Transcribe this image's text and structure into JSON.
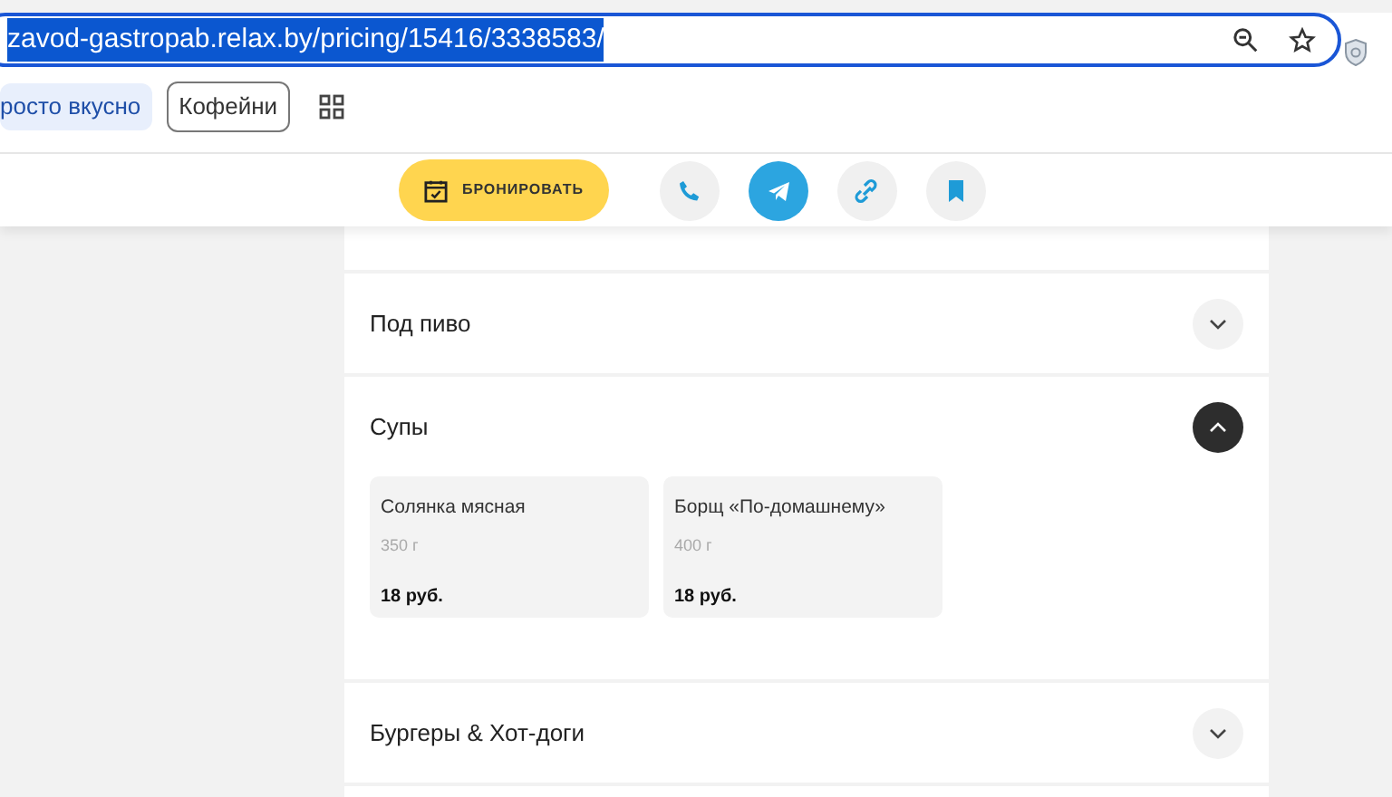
{
  "browser": {
    "url": "zavod-gastropab.relax.by/pricing/15416/3338583/",
    "url_selected": true,
    "bookmarks": [
      {
        "label": "росто вкусно",
        "kind": "chip"
      },
      {
        "label": "Кофейни",
        "kind": "outlined"
      }
    ]
  },
  "action_bar": {
    "book_button": "БРОНИРОВАТЬ",
    "icon_buttons": [
      {
        "kind": "phone",
        "filled": false
      },
      {
        "kind": "telegram",
        "filled": true
      },
      {
        "kind": "link",
        "filled": false
      },
      {
        "kind": "bookmark",
        "filled": false
      }
    ]
  },
  "menu_sections": [
    {
      "title": "Под пиво",
      "expanded": false
    },
    {
      "title": "Супы",
      "expanded": true,
      "items": [
        {
          "name": "Солянка мясная",
          "weight": "350 г",
          "price": "18 руб."
        },
        {
          "name": "Борщ «По-домашнему»",
          "weight": "400 г",
          "price": "18 руб."
        }
      ]
    },
    {
      "title": "Бургеры & Хот-доги",
      "expanded": false
    }
  ]
}
